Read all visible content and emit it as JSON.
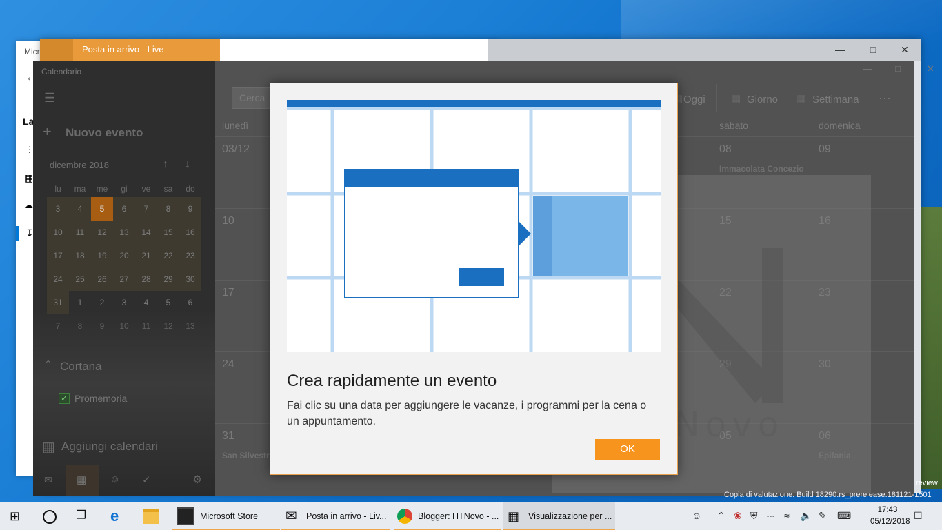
{
  "store": {
    "title": "Micr",
    "sidebar_heading": "La"
  },
  "mail": {
    "title": "Posta in arrivo - Live"
  },
  "calendar": {
    "title": "Calendario",
    "new_event": "Nuovo evento",
    "month_label": "dicembre 2018",
    "weekdays": [
      "lu",
      "ma",
      "me",
      "gi",
      "ve",
      "sa",
      "do"
    ],
    "weeks": [
      [
        "3",
        "4",
        "5",
        "6",
        "7",
        "8",
        "9"
      ],
      [
        "10",
        "11",
        "12",
        "13",
        "14",
        "15",
        "16"
      ],
      [
        "17",
        "18",
        "19",
        "20",
        "21",
        "22",
        "23"
      ],
      [
        "24",
        "25",
        "26",
        "27",
        "28",
        "29",
        "30"
      ],
      [
        "31",
        "1",
        "2",
        "3",
        "4",
        "5",
        "6"
      ],
      [
        "7",
        "8",
        "9",
        "10",
        "11",
        "12",
        "13"
      ]
    ],
    "today": "5",
    "cortana": "Cortana",
    "promemoria": "Promemoria",
    "add_calendars": "Aggiungi calendari",
    "search_placeholder": "Cerca",
    "toolbar": {
      "today": "Oggi",
      "day": "Giorno",
      "week": "Settimana",
      "more": "···"
    },
    "col_headers": {
      "monday": "lunedì",
      "saturday": "sabato",
      "sunday": "domenica"
    },
    "rows": [
      {
        "mon": "03/12",
        "sat": "08",
        "sun": "09",
        "sat_event": "Immacolata Concezio",
        "mon_event": "",
        "sun_event": ""
      },
      {
        "mon": "10",
        "sat": "15",
        "sun": "16",
        "sat_event": "",
        "mon_event": "",
        "sun_event": ""
      },
      {
        "mon": "17",
        "sat": "22",
        "sun": "23",
        "sat_event": "",
        "mon_event": "",
        "sun_event": ""
      },
      {
        "mon": "24",
        "sat": "29",
        "sun": "30",
        "sat_event": "",
        "mon_event": "",
        "sun_event": ""
      },
      {
        "mon": "31",
        "sat": "05",
        "sun": "06",
        "sat_event": "",
        "mon_event": "San Silvestr",
        "sun_event": "Epifania"
      }
    ]
  },
  "dialog": {
    "title": "Crea rapidamente un evento",
    "text": "Fai clic su una data per aggiungere le vacanze, i programmi per la cena o un appuntamento.",
    "ok": "OK"
  },
  "watermark": {
    "brand": "HTNovo"
  },
  "desktop": {
    "build": "Copia di valutazione. Build 18290.rs_prerelease.181121-1501",
    "review": "review"
  },
  "taskbar": {
    "apps": [
      {
        "label": "Microsoft Store",
        "icon": "store-icon"
      },
      {
        "label": "Posta in arrivo - Liv...",
        "icon": "mail-icon"
      },
      {
        "label": "Blogger: HTNovo - ...",
        "icon": "chrome-icon"
      },
      {
        "label": "Visualizzazione per ...",
        "icon": "calendar-icon"
      }
    ],
    "time": "17:43",
    "date": "05/12/2018"
  },
  "colors": {
    "accent": "#f7941d",
    "dialog_blue": "#1a6fc1",
    "calendar_today": "#a85e12"
  }
}
